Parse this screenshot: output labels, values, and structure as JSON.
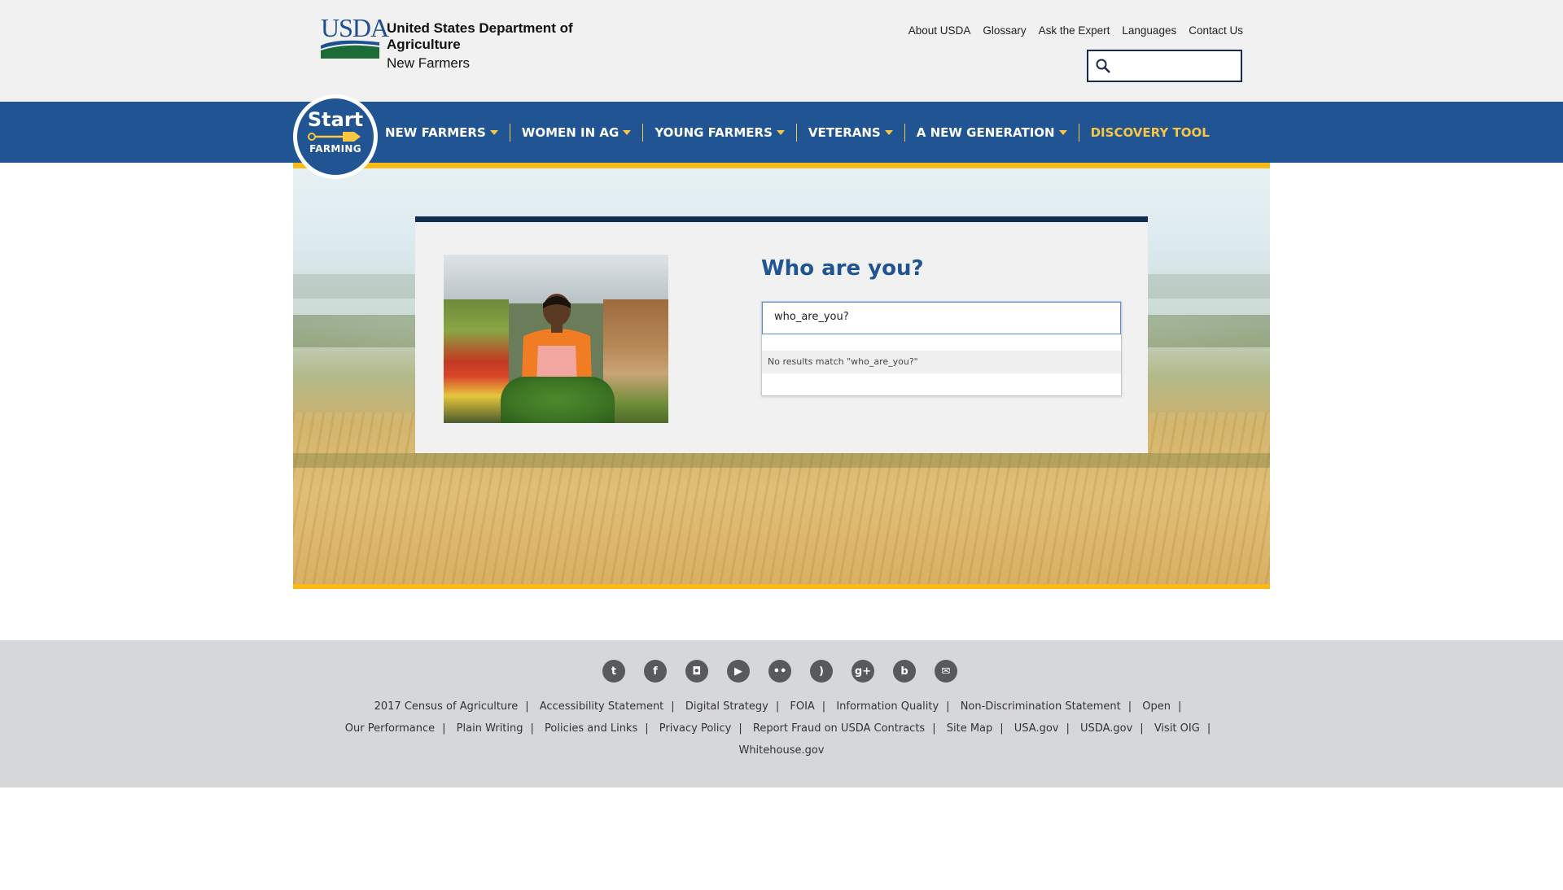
{
  "header": {
    "logo_abbr": "USDA",
    "logo_title": "United States Department of Agriculture",
    "logo_subtitle": "New Farmers",
    "util_links": [
      "About USDA",
      "Glossary",
      "Ask the Expert",
      "Languages",
      "Contact Us"
    ],
    "search_value": ""
  },
  "badge": {
    "start": "Start",
    "farming": "FARMING"
  },
  "nav": {
    "items": [
      "NEW FARMERS",
      "WOMEN IN AG",
      "YOUNG FARMERS",
      "VETERANS",
      "A NEW GENERATION"
    ],
    "discovery": "DISCOVERY TOOL"
  },
  "panel": {
    "title": "Who are you?",
    "input_value": "who_are_you?",
    "no_results": "No results match \"who_are_you?\""
  },
  "footer": {
    "social": [
      {
        "name": "twitter-icon",
        "glyph": "t"
      },
      {
        "name": "facebook-icon",
        "glyph": "f"
      },
      {
        "name": "instagram-icon",
        "glyph": "◘"
      },
      {
        "name": "youtube-icon",
        "glyph": "▶"
      },
      {
        "name": "flickr-icon",
        "glyph": "••"
      },
      {
        "name": "rss-icon",
        "glyph": ")"
      },
      {
        "name": "google-plus-icon",
        "glyph": "g+"
      },
      {
        "name": "blog-icon",
        "glyph": "b"
      },
      {
        "name": "email-icon",
        "glyph": "✉"
      }
    ],
    "links": [
      "2017 Census of Agriculture",
      "Accessibility Statement",
      "Digital Strategy",
      "FOIA",
      "Information Quality",
      "Non-Discrimination Statement",
      "Open",
      "Our Performance",
      "Plain Writing",
      "Policies and Links",
      "Privacy Policy",
      "Report Fraud on USDA Contracts",
      "Site Map",
      "USA.gov",
      "USDA.gov",
      "Visit OIG",
      "Whitehouse.gov"
    ]
  },
  "colors": {
    "nav_blue": "#205493",
    "gold": "#f9b916",
    "title_blue": "#205493",
    "dark_navy": "#112e51"
  }
}
